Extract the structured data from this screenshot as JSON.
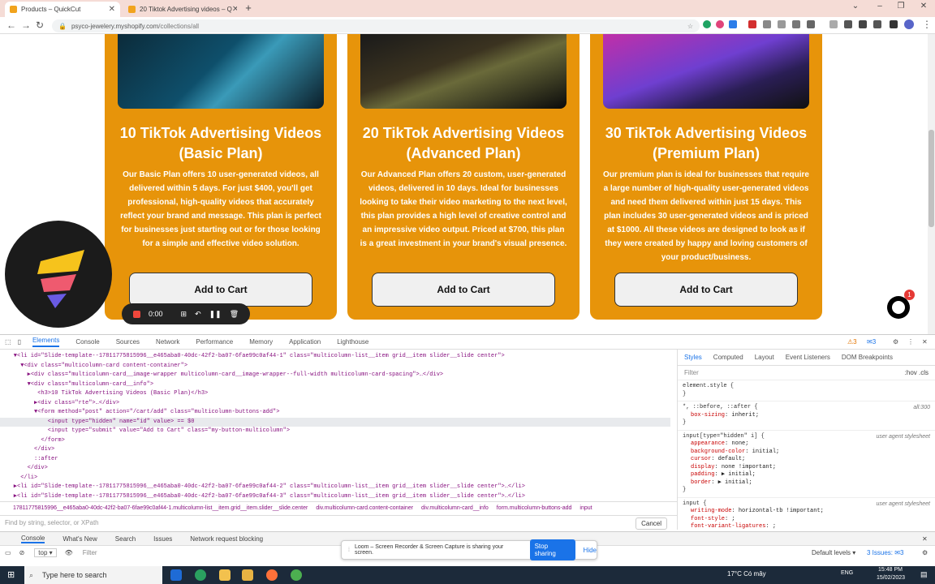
{
  "browser": {
    "tabs": [
      {
        "title": "Products – QuickCut",
        "active": true
      },
      {
        "title": "20 Tiktok Advertising videos – Q",
        "active": false
      }
    ],
    "url_host": "psyco-jewelery.myshopify.com",
    "url_path": "/collections/all"
  },
  "page": {
    "cards": [
      {
        "title": "10 TikTok Advertising Videos (Basic Plan)",
        "description": "Our Basic Plan offers 10 user-generated videos, all delivered within 5 days. For just $400, you'll get professional, high-quality videos that accurately reflect your brand and message. This plan is perfect for businesses just starting out or for those looking for a simple and effective video solution.",
        "button": "Add to Cart"
      },
      {
        "title": "20 TikTok Advertising Videos (Advanced Plan)",
        "description": "Our Advanced Plan offers 20 custom, user-generated videos, delivered in 10 days. Ideal for businesses looking to take their video marketing to the next level, this plan provides a high level of creative control and an impressive video output. Priced at $700, this plan is a great investment in your brand's visual presence.",
        "button": "Add to Cart"
      },
      {
        "title": "30 TikTok Advertising Videos (Premium Plan)",
        "description": "Our premium plan is ideal for businesses that require a large number of high-quality user-generated videos and need them delivered within just 15 days. This plan includes 30 user-generated videos and is priced at $1000. All these videos are designed to look as if they were created by happy and loving customers of your product/business.",
        "button": "Add to Cart"
      }
    ],
    "chat_badge": "1"
  },
  "loom": {
    "timer": "0:00",
    "share_text": "Loom – Screen Recorder & Screen Capture is sharing your screen.",
    "stop_label": "Stop sharing",
    "hide_label": "Hide"
  },
  "devtools": {
    "tabs": [
      "Elements",
      "Console",
      "Sources",
      "Network",
      "Performance",
      "Memory",
      "Application",
      "Lighthouse"
    ],
    "warn_count": "3",
    "info_count": "3",
    "dom_lines": [
      "    ▼<li id=\"Slide-template--17811775815996__e465aba0-40dc-42f2-ba07-6fae99c0af44-1\" class=\"multicolumn-list__item grid__item slider__slide center\">",
      "      ▼<div class=\"multicolumn-card content-container\">",
      "        ▶<div class=\"multicolumn-card__image-wrapper multicolumn-card__image-wrapper--full-width multicolumn-card-spacing\">…</div>",
      "        ▼<div class=\"multicolumn-card__info\">",
      "           <h3>10 TikTok Advertising Videos (Basic Plan)</h3>",
      "          ▶<div class=\"rte\">…</div>",
      "          ▼<form method=\"post\" action=\"/cart/add\" class=\"multicolumn-buttons-add\">",
      "              <input type=\"hidden\" name=\"id\" value> == $0",
      "              <input type=\"submit\" value=\"Add to Cart\" class=\"my-button-multicolumn\">",
      "            </form>",
      "          </div>",
      "          ::after",
      "        </div>",
      "      </li>",
      "    ▶<li id=\"Slide-template--17811775815996__e465aba0-40dc-42f2-ba07-6fae99c0af44-2\" class=\"multicolumn-list__item grid__item slider__slide center\">…</li>",
      "    ▶<li id=\"Slide-template--17811775815996__e465aba0-40dc-42f2-ba07-6fae99c0af44-3\" class=\"multicolumn-list__item grid__item slider__slide center\">…</li>"
    ],
    "styles_tabs": [
      "Styles",
      "Computed",
      "Layout",
      "Event Listeners",
      "DOM Breakpoints"
    ],
    "filter_placeholder": "Filter",
    "filter_hints": ":hov .cls",
    "breadcrumb": [
      "17811775815996__e465aba0-40dc-42f2-ba07-6fae99c0af44-1.multicolumn-list__item.grid__item.slider__slide.center",
      "div.multicolumn-card.content-container",
      "div.multicolumn-card__info",
      "form.multicolumn-buttons-add",
      "input"
    ],
    "find_placeholder": "Find by string, selector, or XPath",
    "cancel_label": "Cancel",
    "drawer_tabs": [
      "Console",
      "What's New",
      "Search",
      "Issues",
      "Network request blocking"
    ],
    "console_context": "top",
    "console_filter": "Filter",
    "levels_label": "Default levels",
    "issues_label": "3 Issues:",
    "issues_count": "3"
  },
  "taskbar": {
    "search_placeholder": "Type here to search",
    "weather": "17°C  Có mây",
    "lang": "ENG",
    "time": "15:48 PM",
    "date": "15/02/2023"
  }
}
